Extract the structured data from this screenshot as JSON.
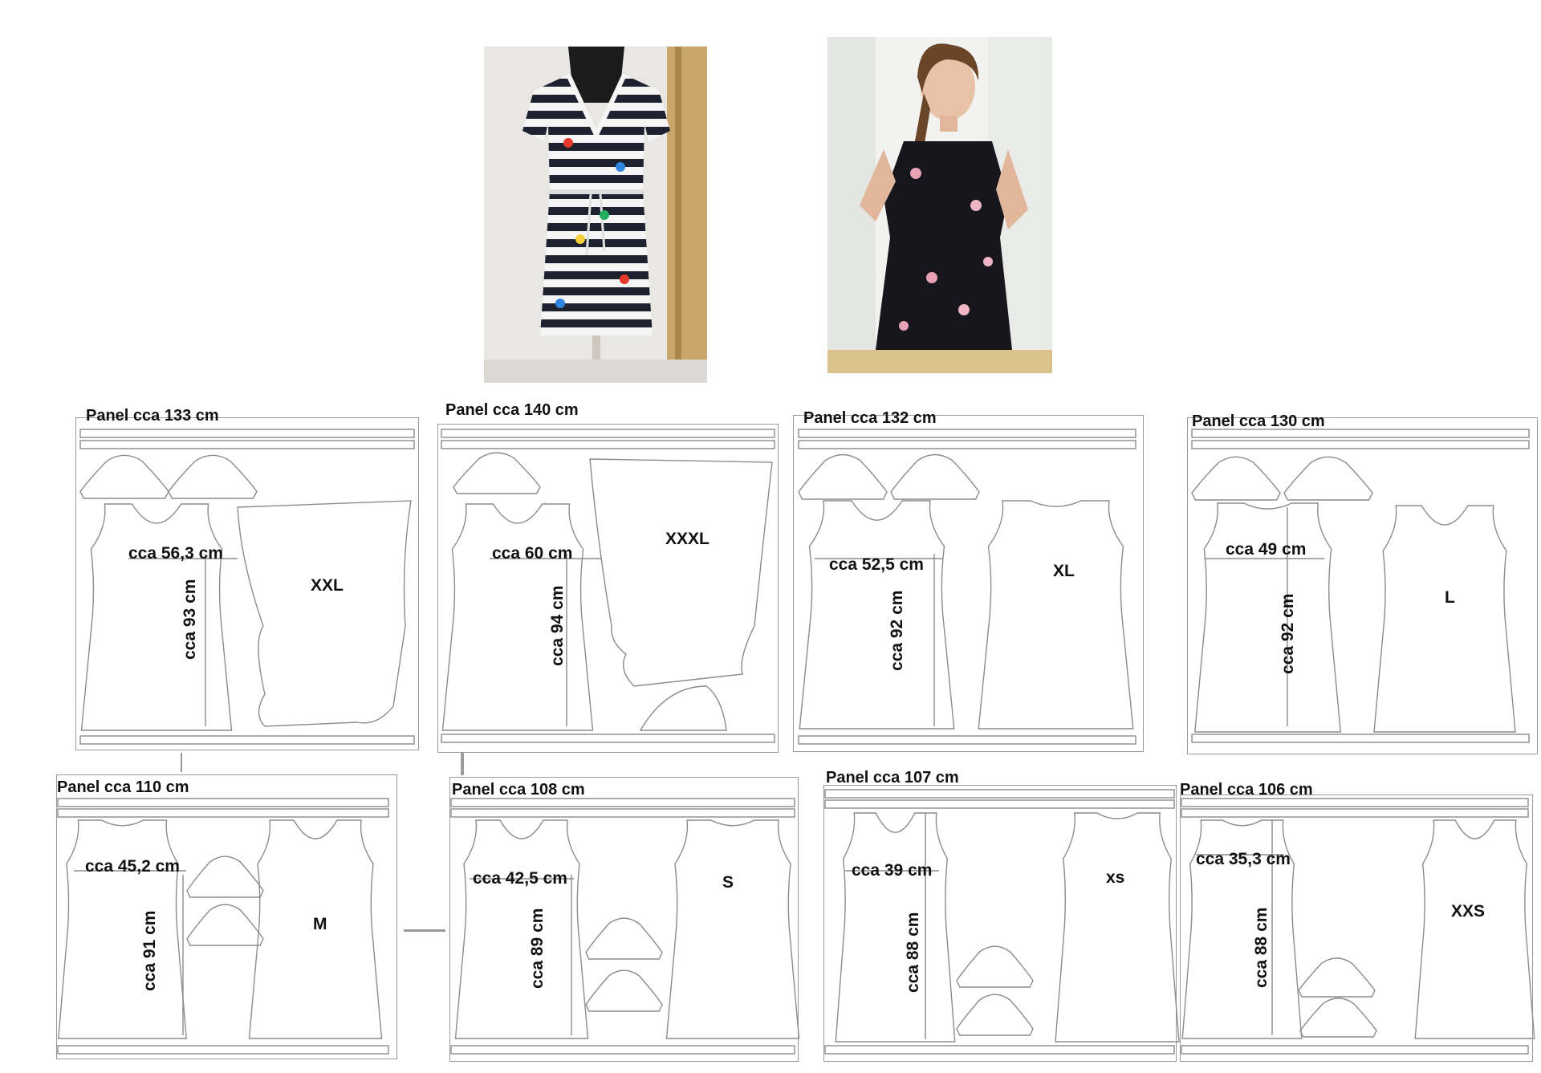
{
  "photos": [
    {
      "name": "photo-striped-dress",
      "alt": "striped dress on dress form"
    },
    {
      "name": "photo-floral-dress",
      "alt": "woman wearing floral dress"
    }
  ],
  "panels": [
    {
      "id": "xxl",
      "title": "Panel cca 133 cm",
      "width": "cca 56,3 cm",
      "length": "cca 93 cm",
      "size": "XXL"
    },
    {
      "id": "xxxl",
      "title": "Panel cca 140 cm",
      "width": "cca 60 cm",
      "length": "cca 94 cm",
      "size": "XXXL"
    },
    {
      "id": "xl",
      "title": "Panel cca 132 cm",
      "width": "cca 52,5 cm",
      "length": "cca 92 cm",
      "size": "XL"
    },
    {
      "id": "l",
      "title": "Panel cca 130 cm",
      "width": "cca 49 cm",
      "length": "cca 92 cm",
      "size": "L"
    },
    {
      "id": "m",
      "title": "Panel cca 110 cm",
      "width": "cca 45,2 cm",
      "length": "cca 91 cm",
      "size": "M"
    },
    {
      "id": "s",
      "title": "Panel cca 108 cm",
      "width": "cca 42,5 cm",
      "length": "cca 89 cm",
      "size": "S"
    },
    {
      "id": "xs",
      "title": "Panel cca 107 cm",
      "width": "cca 39 cm",
      "length": "cca 88 cm",
      "size": "xs"
    },
    {
      "id": "xxs",
      "title": "Panel cca 106 cm",
      "width": "cca 35,3 cm",
      "length": "cca 88 cm",
      "size": "XXS"
    }
  ]
}
